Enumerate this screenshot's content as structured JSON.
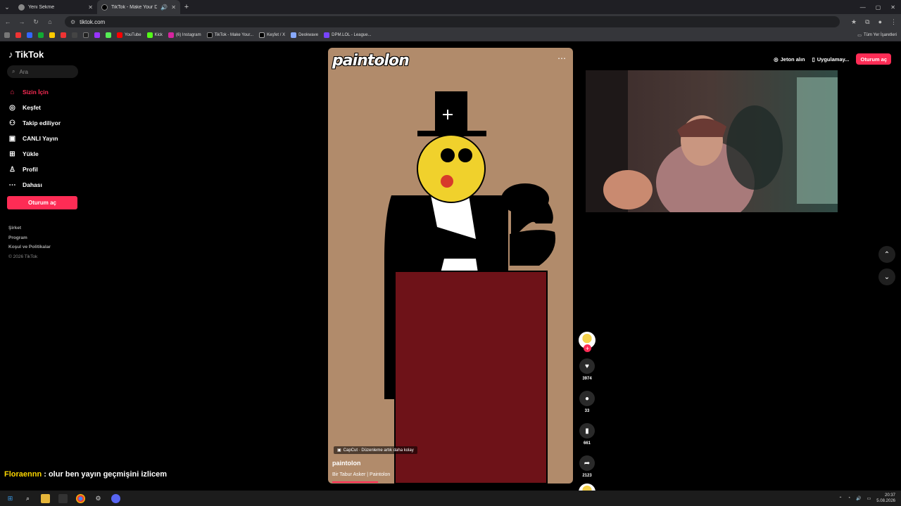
{
  "browser": {
    "tabs": [
      {
        "title": "Yeni Sekme",
        "active": false
      },
      {
        "title": "TikTok - Make Your Day",
        "active": true
      }
    ],
    "url": "tiktok.com",
    "bookmarks": [
      "YouTube",
      "Kick",
      "(6) Instagram",
      "TikTok - Make Your...",
      "Keşfet / X",
      "Deokwave",
      "DPM.LOL - League..."
    ],
    "all_bookmarks": "Tüm Yer İşaretleri"
  },
  "sidebar": {
    "logo": "TikTok",
    "search_placeholder": "Ara",
    "items": [
      {
        "label": "Sizin İçin",
        "icon": "home-icon",
        "active": true
      },
      {
        "label": "Keşfet",
        "icon": "compass-icon",
        "active": false
      },
      {
        "label": "Takip ediliyor",
        "icon": "following-icon",
        "active": false
      },
      {
        "label": "CANLI Yayın",
        "icon": "live-icon",
        "active": false
      },
      {
        "label": "Yükle",
        "icon": "upload-icon",
        "active": false
      },
      {
        "label": "Profil",
        "icon": "profile-icon",
        "active": false
      },
      {
        "label": "Dahası",
        "icon": "more-icon",
        "active": false
      }
    ],
    "login": "Oturum aç",
    "footer": [
      "Şirket",
      "Program",
      "Koşul ve Politikalar"
    ],
    "copyright": "© 2026 TikTok"
  },
  "header": {
    "coins": "Jeton alın",
    "app": "Uygulamay...",
    "login": "Oturum aç"
  },
  "video": {
    "watermark": "paintolon",
    "capcut": "CapCut · Düzenleme artık daha kolay",
    "author": "paintolon",
    "sound": "Bir Tabur Asker | Paintolon"
  },
  "actions": {
    "likes": "3974",
    "comments": "33",
    "saves": "661",
    "shares": "2123"
  },
  "chat": {
    "user": "Floraennn",
    "message": " : olur ben yayın geçmişini izlicem"
  },
  "taskbar": {
    "time": "20:37",
    "date": "5.08.2026"
  },
  "colors": {
    "accent": "#fe2c55",
    "video_bg": "#b18b6b",
    "podium": "#6e1218",
    "face": "#f0d12c"
  }
}
